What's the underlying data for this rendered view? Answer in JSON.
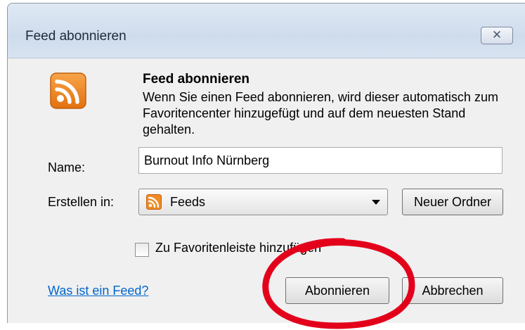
{
  "window": {
    "title": "Feed abonnieren",
    "close_glyph": "☒"
  },
  "dialog": {
    "icon": "rss-feed-icon",
    "heading": "Feed abonnieren",
    "description": "Wenn Sie einen Feed abonnieren, wird dieser automatisch zum Favoritencenter hinzugefügt und auf dem neuesten Stand gehalten.",
    "name_label": "Name:",
    "name_value": "Burnout Info Nürnberg",
    "create_in_label": "Erstellen in:",
    "create_in_value": "Feeds",
    "new_folder_button": "Neuer Ordner",
    "checkbox_label": "Zu Favoritenleiste hinzufügen",
    "checkbox_checked": false,
    "help_link": "Was ist ein Feed?",
    "subscribe_button": "Abonnieren",
    "cancel_button": "Abbrechen"
  },
  "annotation": {
    "shape": "hand-drawn ellipse",
    "color": "#e3001b",
    "target": "subscribe_button"
  },
  "colors": {
    "rss_orange": "#f08a24",
    "link_blue": "#0066cc",
    "annotation_red": "#e3001b"
  }
}
